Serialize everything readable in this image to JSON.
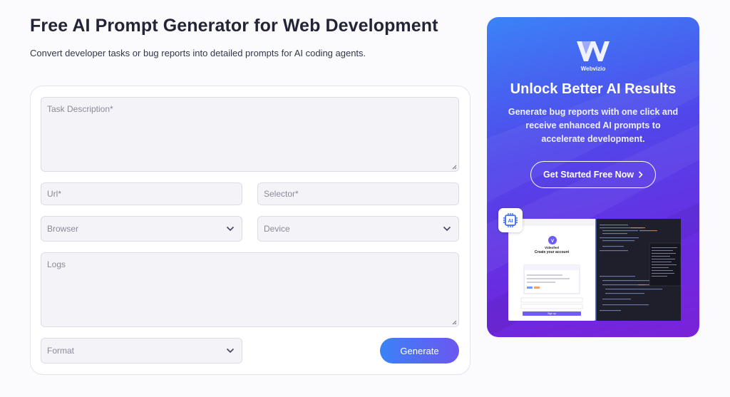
{
  "page": {
    "title": "Free AI Prompt Generator for Web Development",
    "subtitle": "Convert developer tasks or bug reports into detailed prompts for AI coding agents."
  },
  "form": {
    "task_description": {
      "placeholder": "Task Description*",
      "value": ""
    },
    "url": {
      "placeholder": "Url*",
      "value": ""
    },
    "selector": {
      "placeholder": "Selector*",
      "value": ""
    },
    "browser": {
      "placeholder": "Browser",
      "icon": "chevron-down-icon"
    },
    "device": {
      "placeholder": "Device",
      "icon": "chevron-down-icon"
    },
    "logs": {
      "placeholder": "Logs",
      "value": ""
    },
    "format": {
      "placeholder": "Format",
      "icon": "chevron-down-icon"
    },
    "generate_label": "Generate"
  },
  "promo": {
    "brand": "Webvizio",
    "title": "Unlock Better AI Results",
    "text": "Generate bug reports with one click and receive enhanced AI prompts to accelerate development.",
    "cta_label": "Get Started Free Now",
    "cta_icon": "chevron-right-icon",
    "badge_icon": "ai-chip-icon",
    "preview_app_name": "Videofeel",
    "preview_heading": "Create your account",
    "preview_button": "Sign up"
  },
  "colors": {
    "accent_start": "#3b82f6",
    "accent_end": "#6b57f0",
    "promo_gradient_top": "#3b83f7",
    "promo_gradient_bottom": "#7a22d8"
  }
}
